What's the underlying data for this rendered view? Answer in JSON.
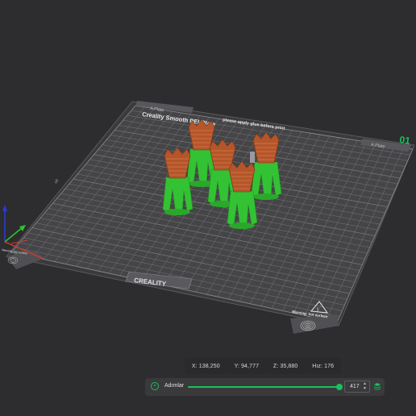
{
  "plate": {
    "a_plate_tab": "A Plate",
    "title": "Creality Smooth PEI Plate",
    "notice": "please apply glue before print",
    "brand": "CREALITY",
    "warning": "Warning: hot surface",
    "warning_small": "Warning: hot surface",
    "plate_number": "01",
    "corner_label": "x8"
  },
  "status": {
    "x": "X: 138,250",
    "y": "Y: 94,777",
    "z": "Z: 35,880",
    "speed": "Hız: 176"
  },
  "slider": {
    "label": "Adımlar",
    "value": "417",
    "progress": 1.0
  },
  "colors": {
    "background": "#2d2d30",
    "plate": "#3f3f42",
    "grid": "#6a6a6e",
    "accent": "#19c05a",
    "support": "#33c233",
    "model": "#b5552a"
  },
  "icons": [
    "play-icon",
    "layers-icon",
    "axis-gizmo-icon",
    "fingerprint-icon",
    "warning-triangle-icon"
  ]
}
